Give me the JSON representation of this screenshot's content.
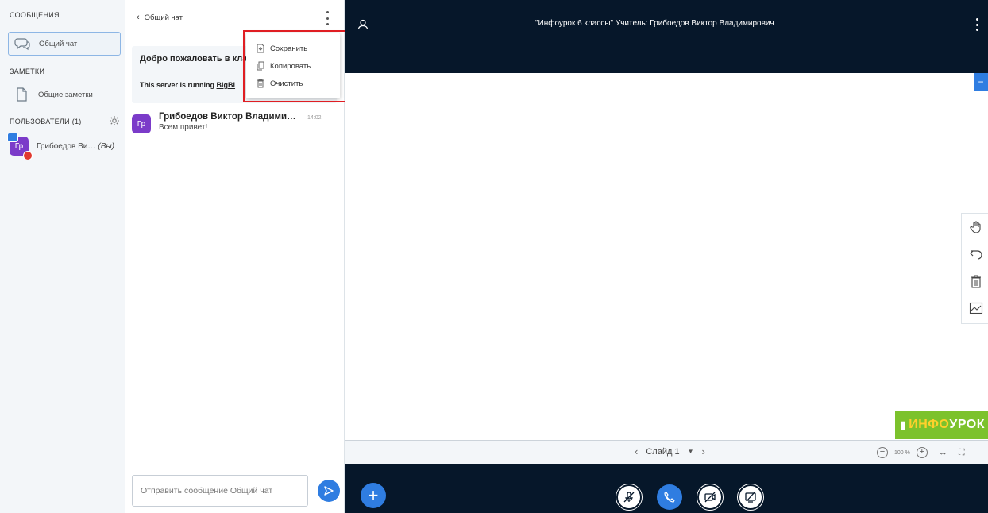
{
  "sidebar": {
    "messages_heading": "СООБЩЕНИЯ",
    "public_chat": "Общий чат",
    "notes_heading": "ЗАМЕТКИ",
    "shared_notes": "Общие заметки",
    "users_heading": "ПОЛЬЗОВАТЕЛИ (1)",
    "user": {
      "avatar": "Гр",
      "name": "Грибоедов Ви…",
      "you": "(Вы)"
    }
  },
  "chat": {
    "back_label": "Общий чат",
    "welcome_title": "Добро пожаловать в кла",
    "welcome_server_prefix": "This server is running ",
    "welcome_server_link": "BigBl",
    "message": {
      "avatar": "Гр",
      "author": "Грибоедов Виктор Владимиро…",
      "time": "14:02",
      "text": "Всем привет!"
    },
    "input_placeholder": "Отправить сообщение Общий чат"
  },
  "menu": {
    "items": [
      "Сохранить",
      "Копировать",
      "Очистить"
    ],
    "highlight_color": "#e01e23"
  },
  "presentation": {
    "title": "\"Инфоурок 6 классы\" Учитель: Грибоедов Виктор Владимирович",
    "logo_prefix": "ИНФО",
    "logo_suffix": "УРОК",
    "slide_label": "Слайд 1",
    "zoom": "100 %"
  },
  "colors": {
    "navy": "#06172a",
    "accent": "#2f7de1",
    "avatar": "#7b3bc9",
    "logo": "#7cc22c"
  }
}
